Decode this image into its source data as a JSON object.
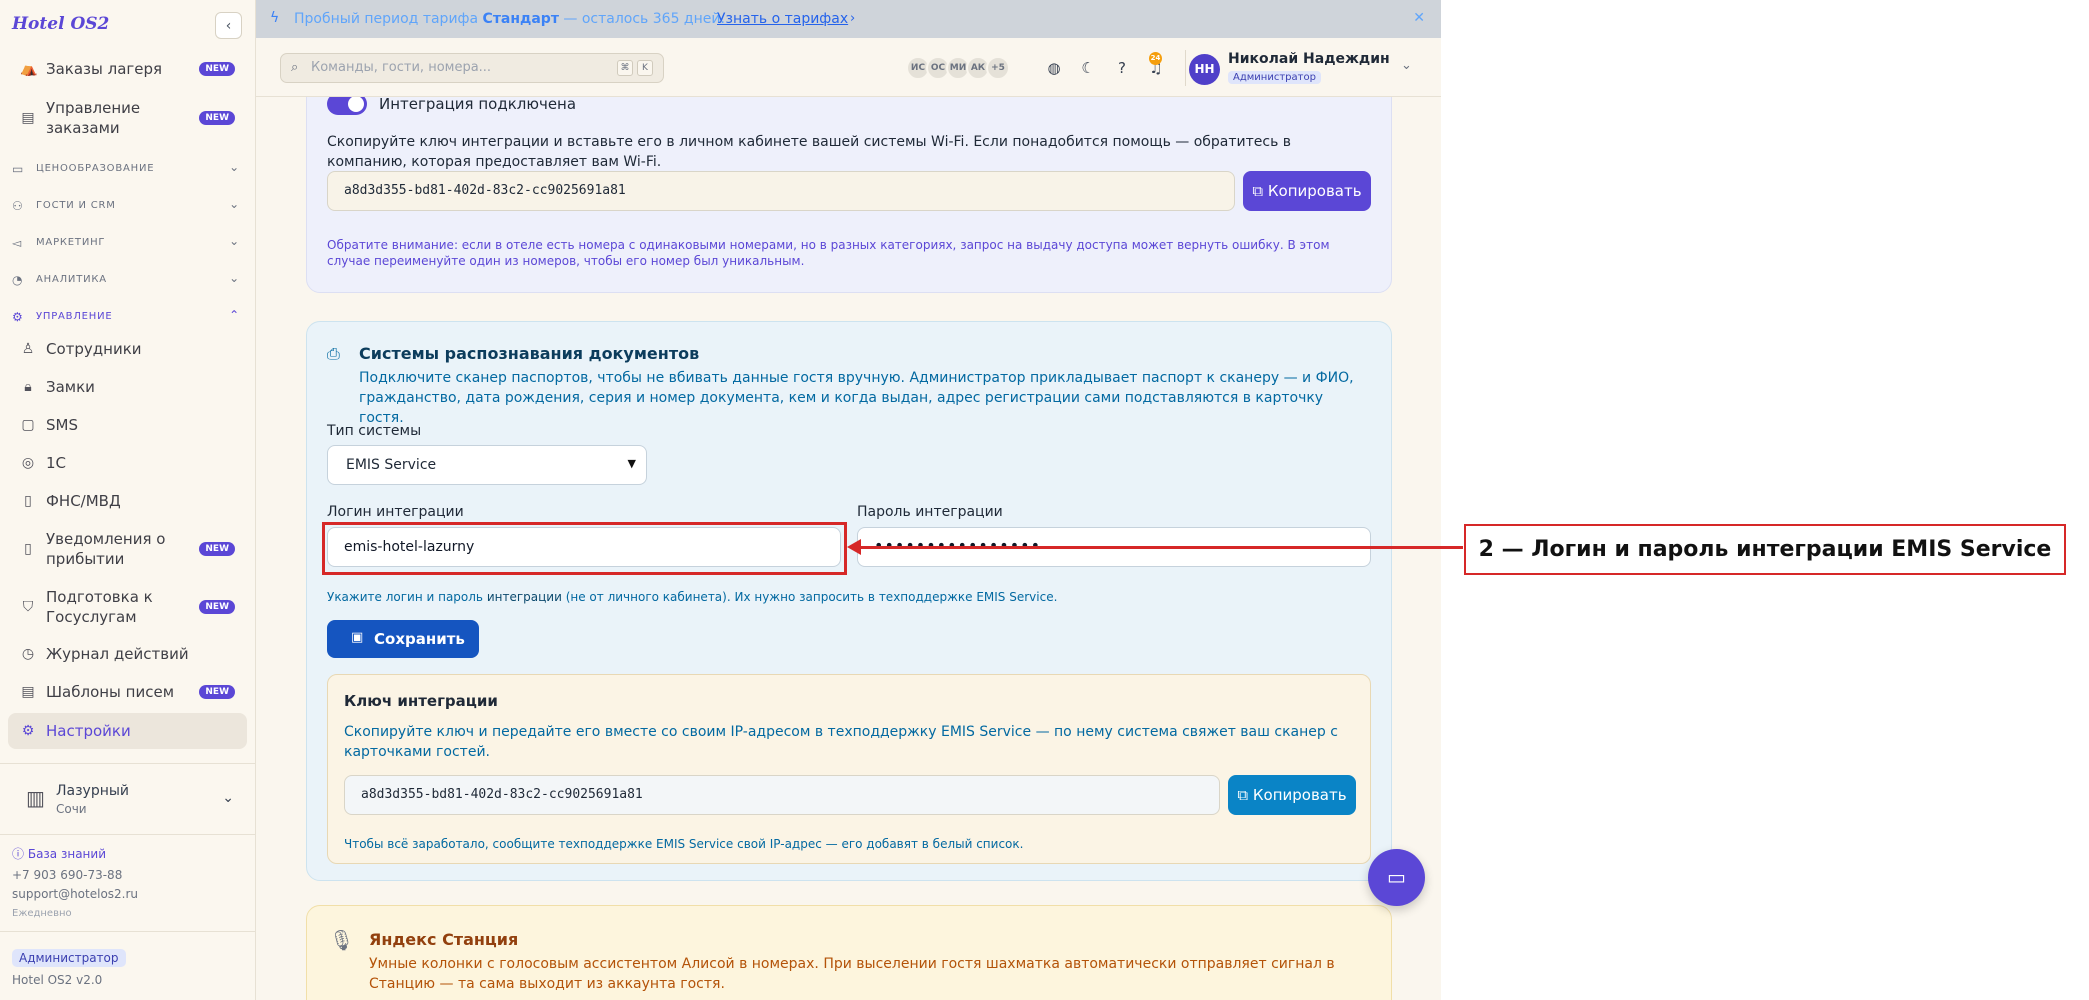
{
  "app": {
    "brand": "Hotel OS2"
  },
  "sidebar": {
    "top_items": [
      {
        "label": "Заказы лагеря",
        "badge": "NEW",
        "icon": "tent-icon"
      },
      {
        "label_line1": "Управление",
        "label_line2": "заказами",
        "badge": "NEW",
        "icon": "receipt-icon"
      }
    ],
    "sections": [
      {
        "label": "ЦЕНООБРАЗОВАНИЕ",
        "icon": "wallet-icon"
      },
      {
        "label": "ГОСТИ И CRM",
        "icon": "users-icon"
      },
      {
        "label": "МАРКЕТИНГ",
        "icon": "megaphone-icon"
      },
      {
        "label": "АНАЛИТИКА",
        "icon": "clock-icon"
      },
      {
        "label": "УПРАВЛЕНИЕ",
        "icon": "gear-icon"
      }
    ],
    "items": [
      {
        "label": "Сотрудники",
        "icon": "user-icon"
      },
      {
        "label": "Замки",
        "icon": "lock-icon"
      },
      {
        "label": "SMS",
        "icon": "chat-icon"
      },
      {
        "label": "1С",
        "icon": "database-icon"
      },
      {
        "label": "ФНС/МВД",
        "icon": "document-icon"
      },
      {
        "label_line1": "Уведомления о",
        "label_line2": "прибытии",
        "badge": "NEW",
        "icon": "document-icon"
      },
      {
        "label_line1": "Подготовка к",
        "label_line2": "Госуслугам",
        "badge": "NEW",
        "icon": "shield-icon"
      },
      {
        "label": "Журнал действий",
        "icon": "history-icon"
      },
      {
        "label": "Шаблоны писем",
        "badge": "NEW",
        "icon": "mail-icon"
      },
      {
        "label": "Настройки",
        "icon": "gear-icon",
        "active": true
      }
    ],
    "hotel": {
      "name": "Лазурный",
      "city": "Сочи"
    },
    "knowledge_base": "База знаний",
    "phone": "+7 903 690-73-88",
    "email": "support@hotelos2.ru",
    "hours": "Ежедневно",
    "role": "Администратор",
    "version": "Hotel OS2 v2.0"
  },
  "trial": {
    "text_before": "Пробный период тарифа ",
    "plan": "Стандарт",
    "text_after": " — осталось 365 дней.",
    "link": "Узнать о тарифах"
  },
  "header": {
    "search_placeholder": "Команды, гости, номера...",
    "shortcut_keys": [
      "⌘",
      "K"
    ],
    "avatars": [
      "ИС",
      "ОС",
      "МИ",
      "АК",
      "+5"
    ],
    "notifications_count": "24",
    "user_initials": "НН",
    "user_name": "Николай Надеждин",
    "user_role": "Администратор"
  },
  "wifi": {
    "toggle_label": "Интеграция подключена",
    "description": "Скопируйте ключ интеграции и вставьте его в личном кабинете вашей системы Wi-Fi. Если понадобится помощь — обратитесь в компанию, которая предоставляет вам Wi-Fi.",
    "key": "a8d3d355-bd81-402d-83c2-cc9025691a81",
    "copy_label": "Копировать",
    "note": "Обратите внимание: если в отеле есть номера с одинаковыми номерами, но в разных категориях, запрос на выдачу доступа может вернуть ошибку. В этом случае переименуйте один из номеров, чтобы его номер был уникальным."
  },
  "docs": {
    "title": "Системы распознавания документов",
    "description": "Подключите сканер паспортов, чтобы не вбивать данные гостя вручную. Администратор прикладывает паспорт к сканеру — и ФИО, гражданство, дата рождения, серия и номер документа, кем и когда выдан, адрес регистрации сами подставляются в карточку гостя.",
    "system_type_label": "Тип системы",
    "system_type_value": "EMIS Service",
    "login_label": "Логин интеграции",
    "login_value": "emis-hotel-lazurny",
    "password_label": "Пароль интеграции",
    "password_value": "••••••••••••••••",
    "hint_before": "Укажите логин и пароль ",
    "hint_bold": "интеграции",
    "hint_after": " (не от личного кабинета). Их нужно запросить в техподдержке EMIS Service.",
    "save_label": "Сохранить",
    "key_title": "Ключ интеграции",
    "key_description": "Скопируйте ключ и передайте его вместе со своим IP-адресом в техподдержку EMIS Service — по нему система свяжет ваш сканер с карточками гостей.",
    "key_value": "a8d3d355-bd81-402d-83c2-cc9025691a81",
    "copy_label": "Копировать",
    "key_note": "Чтобы всё заработало, сообщите техподдержке EMIS Service свой IP-адрес — его добавят в белый список."
  },
  "yandex": {
    "title": "Яндекс Станция",
    "description": "Умные колонки с голосовым ассистентом Алисой в номерах. При выселении гостя шахматка автоматически отправляет сигнал в Станцию — та сама выходит из аккаунта гостя."
  },
  "annotation": {
    "callout": "2 — Логин и пароль интеграции EMIS Service"
  },
  "colors": {
    "accent": "#5b47d6",
    "primary_blue": "#1555c0",
    "copy_blue": "#0a84c6",
    "annotation_red": "#d62828"
  }
}
